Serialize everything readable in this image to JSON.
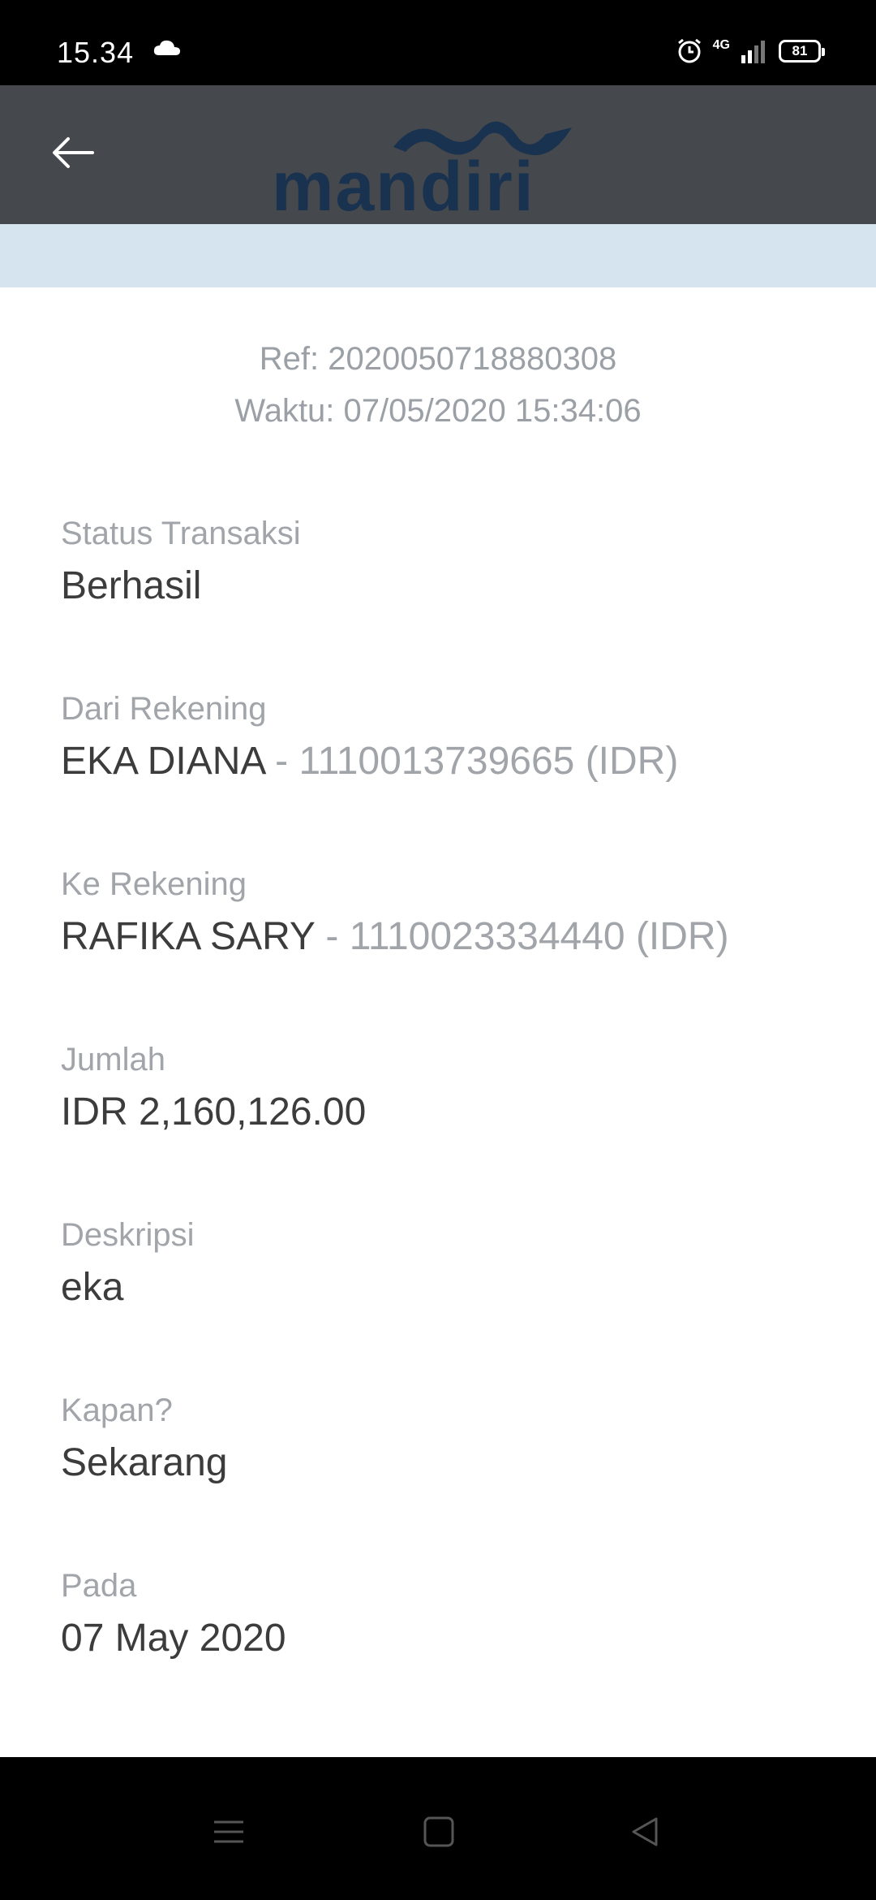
{
  "status_bar": {
    "time": "15.34",
    "network": "4G",
    "battery": "81"
  },
  "header": {
    "logo_text": "mandiri"
  },
  "receipt": {
    "ref_label": "Ref:",
    "ref_value": "2020050718880308",
    "time_label": "Waktu:",
    "time_value": "07/05/2020 15:34:06"
  },
  "fields": [
    {
      "label": "Status Transaksi",
      "value": "Berhasil"
    },
    {
      "label": "Dari Rekening",
      "value": "EKA DIANA",
      "sub": " - 1110013739665 (IDR)"
    },
    {
      "label": "Ke Rekening",
      "value": "RAFIKA SARY",
      "sub": " - 1110023334440 (IDR)"
    },
    {
      "label": "Jumlah",
      "value": "IDR 2,160,126.00"
    },
    {
      "label": "Deskripsi",
      "value": "eka"
    },
    {
      "label": "Kapan?",
      "value": "Sekarang"
    },
    {
      "label": "Pada",
      "value": "07 May 2020"
    }
  ]
}
